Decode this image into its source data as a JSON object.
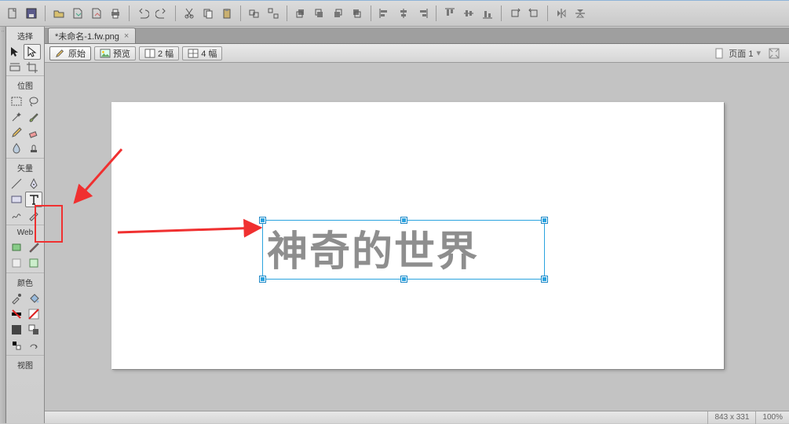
{
  "tab": {
    "title": "*未命名-1.fw.png"
  },
  "view_tabs": {
    "original": "原始",
    "preview": "预览",
    "split2": "2 幅",
    "split4": "4 幅"
  },
  "page_selector": {
    "label": "页面 1"
  },
  "palette": {
    "select_label": "选择",
    "bitmap_label": "位图",
    "vector_label": "矢量",
    "web_label": "Web",
    "color_label": "颜色",
    "view_label": "视图"
  },
  "canvas": {
    "text": "神奇的世界"
  },
  "status": {
    "dims": "843 x 331",
    "zoom": "100%"
  },
  "colors": {
    "annotation": "#f03030",
    "selection": "#2aa3df"
  }
}
